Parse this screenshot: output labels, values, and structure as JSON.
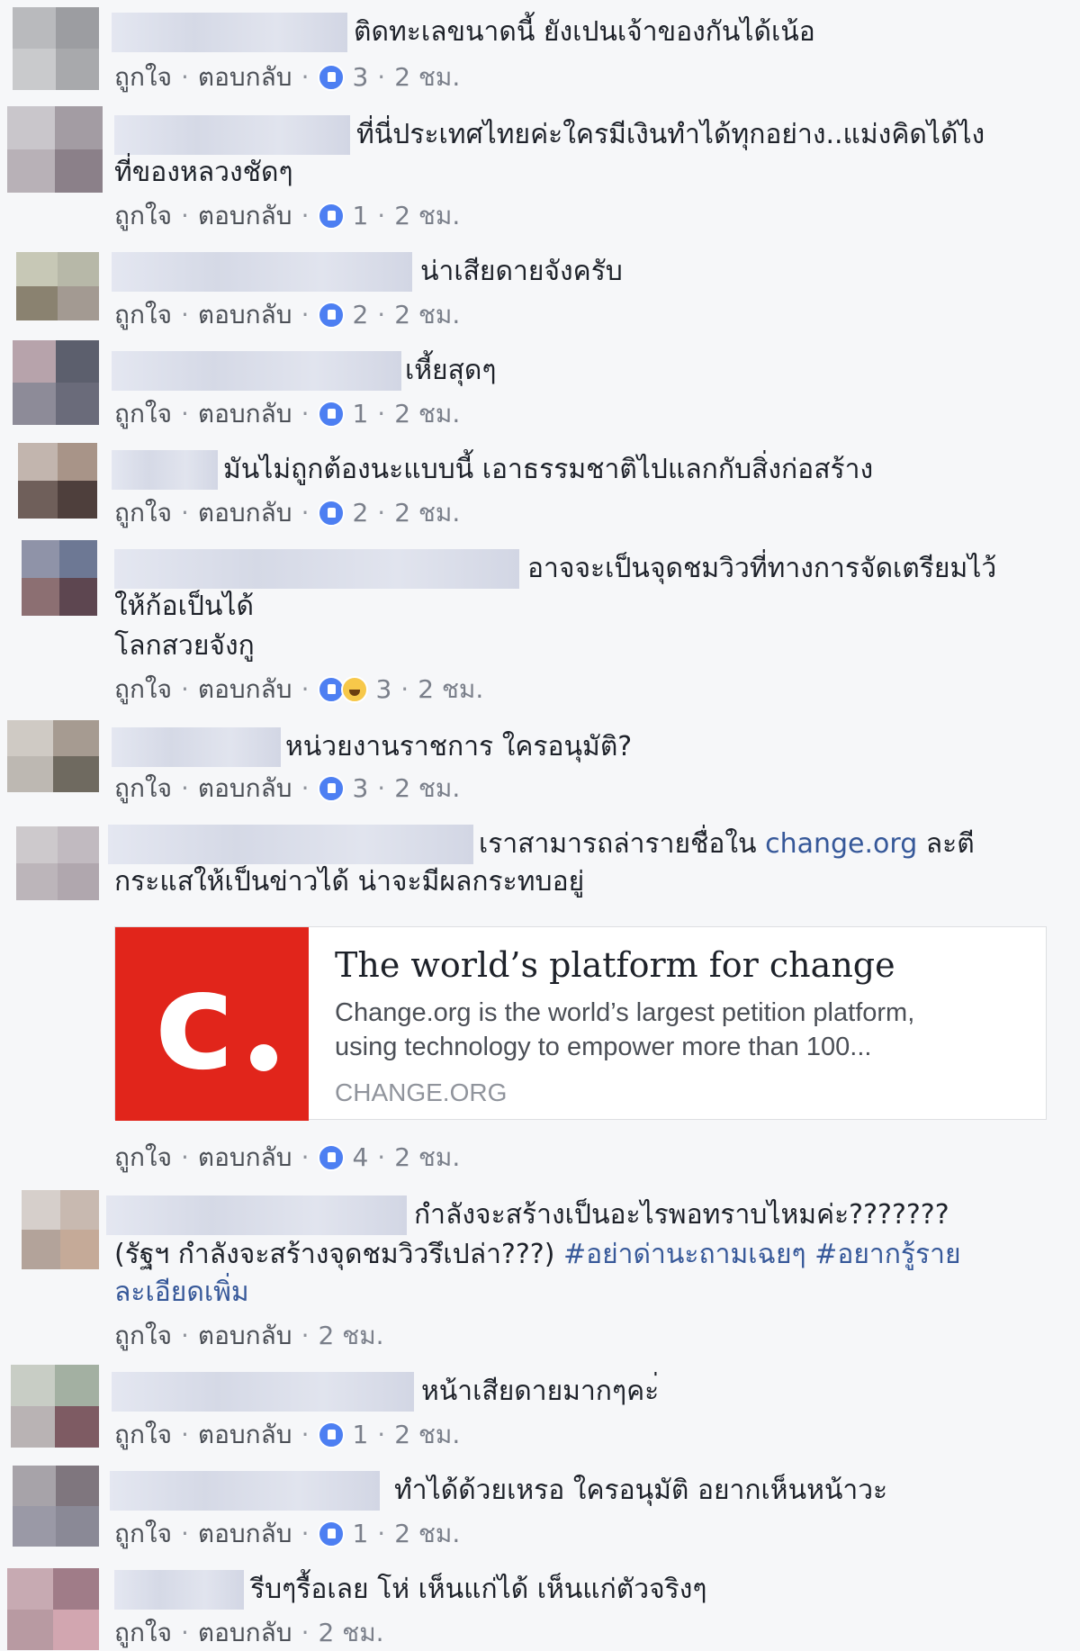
{
  "actions": {
    "like": "ถูกใจ",
    "reply": "ตอบกลับ",
    "separator": "·"
  },
  "comments": [
    {
      "line1": "ติดทะเลขนาดนี้ ยังเปนเจ้าของกันได้เน้อ",
      "reaction_count": "3",
      "time": "2 ชม."
    },
    {
      "line1": "ที่นี่ประเทศไทยค่ะใครมีเงินทำได้ทุกอย่าง..แม่งคิดได้ไง",
      "line2": "ที่ของหลวงชัดๆ",
      "reaction_count": "1",
      "time": "2 ชม."
    },
    {
      "line1": "น่าเสียดายจังครับ",
      "reaction_count": "2",
      "time": "2 ชม."
    },
    {
      "line1": "เหี้ยสุดๆ",
      "reaction_count": "1",
      "time": "2 ชม."
    },
    {
      "line1": "มันไม่ถูกต้องนะแบบนี้ เอาธรรมชาติไปแลกกับสิ่งก่อสร้าง",
      "reaction_count": "2",
      "time": "2 ชม."
    },
    {
      "line1": "อาจจะเป็นจุดชมวิวที่ทางการจัดเตรียมไว้",
      "line2": "ให้ก้อเป็นได้",
      "line3": "โลกสวยจังกู",
      "reaction_count": "3",
      "time": "2 ชม."
    },
    {
      "line1": "หน่วยงานราชการ ใครอนุมัติ?",
      "reaction_count": "3",
      "time": "2 ชม."
    },
    {
      "line1_a": "เราสามารถล่ารายชื่อใน ",
      "line1_link": "change.org",
      "line1_b": " ละตี",
      "line2": "กระแสให้เป็นข่าวได้ น่าจะมีผลกระทบอยู่",
      "reaction_count": "4",
      "time": "2 ชม."
    },
    {
      "line1": "กำลังจะสร้างเป็นอะไรพอทราบไหมค่ะ???????",
      "line2_a": "(รัฐฯ กำลังจะสร้างจุดชมวิวรึเปล่า???) ",
      "line2_link": "#อย่าด่านะถามเฉยๆ #อยากรู้ราย",
      "line3_link": "ละเอียดเพิ่ม",
      "time": "2 ชม."
    },
    {
      "line1": "หน้าเสียดายมากๆคะ่",
      "reaction_count": "1",
      "time": "2 ชม."
    },
    {
      "line1": "ทำได้ด้วยเหรอ ใครอนุมัติ อยากเห็นหน้าวะ",
      "reaction_count": "1",
      "time": "2 ชม."
    },
    {
      "line1": "รีบๆรื้อเลย โห่ เห็นแก่ได้ เห็นแก่ตัวจริงๆ",
      "time": "2 ชม."
    }
  ],
  "link_card": {
    "title": "The world’s platform for change",
    "description_line1": "Change.org is the world’s largest petition platform,",
    "description_line2": "using technology to empower more than 100...",
    "domain": "CHANGE.ORG",
    "logo_letter": "c",
    "logo_color": "#e1251b"
  },
  "colors": {
    "like_blue": "#4d7ff2",
    "link": "#365899",
    "meta": "#90949c",
    "background": "#f6f7f9"
  }
}
